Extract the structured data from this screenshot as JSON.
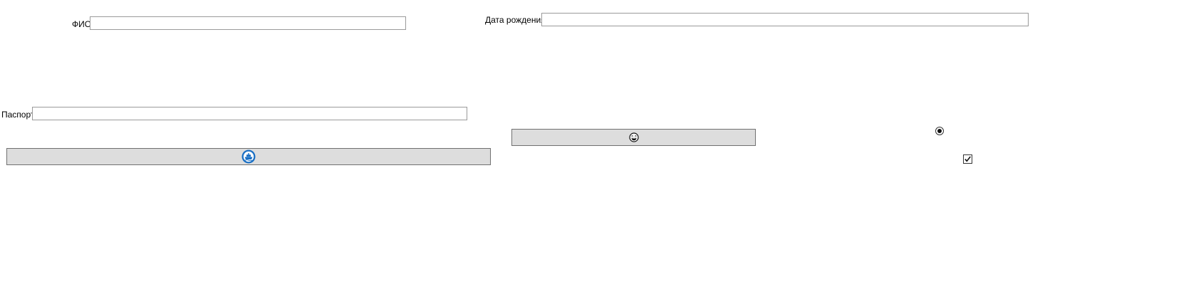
{
  "form": {
    "fio": {
      "label": "ФИО",
      "value": ""
    },
    "birth_date": {
      "label": "Дата рождения",
      "value": ""
    },
    "passport": {
      "label": "Паспорт",
      "value": ""
    }
  },
  "buttons": {
    "primary": {
      "icon": "ship-badge-icon",
      "icon_color": "#1a6fc4"
    },
    "secondary": {
      "icon": "laughing-face-icon"
    }
  },
  "controls": {
    "radio_selected": true,
    "checkbox_checked": true
  }
}
